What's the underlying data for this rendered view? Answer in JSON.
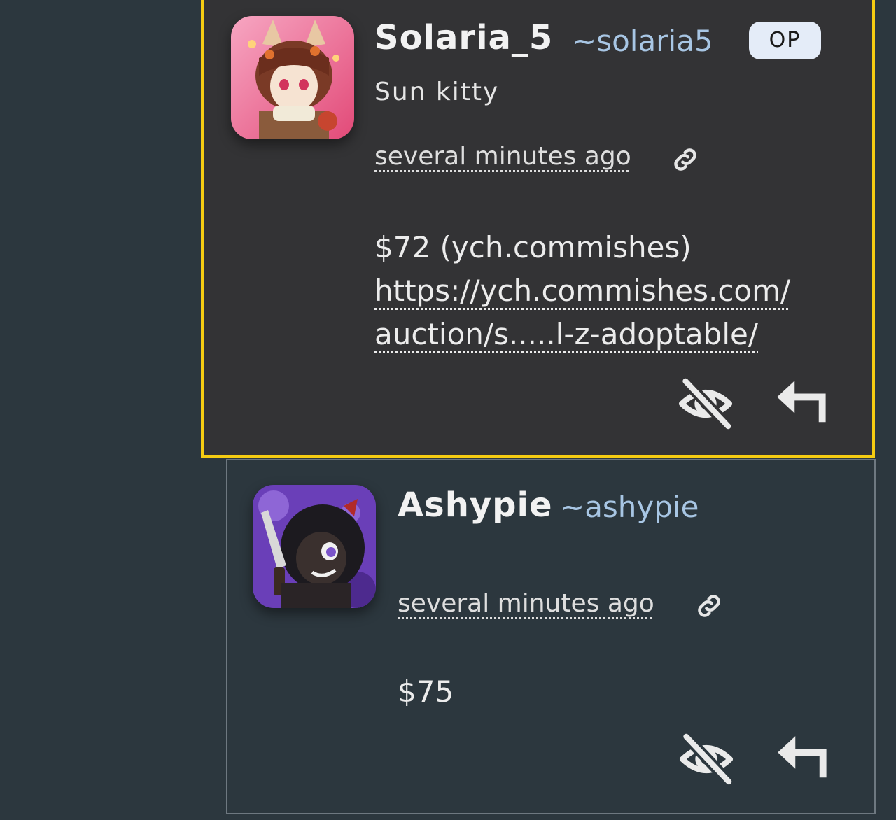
{
  "comments": [
    {
      "display_name": "Solaria_5",
      "handle": "~solaria5",
      "badge": "OP",
      "tagline": "Sun kitty",
      "timestamp": "several minutes ago",
      "body": "$72 (ych.commishes)",
      "link_line1": "https://ych.commishes.com/",
      "link_line2": "auction/s.....l-z-adoptable/",
      "highlighted": true,
      "avatar_icon": "avatar-fox-girl-pink",
      "actions": [
        "hide-icon",
        "reply-icon"
      ]
    },
    {
      "display_name": "Ashypie",
      "handle": "~ashypie",
      "timestamp": "several minutes ago",
      "body": "$75",
      "highlighted": false,
      "avatar_icon": "avatar-dark-cat-purple",
      "actions": [
        "hide-icon",
        "reply-icon"
      ]
    }
  ],
  "colors": {
    "page_bg": "#2c373e",
    "highlight_border": "#f5cc12",
    "highlight_bg": "#333335",
    "handle": "#a8c6e4",
    "badge_bg": "#e4ecf8"
  }
}
